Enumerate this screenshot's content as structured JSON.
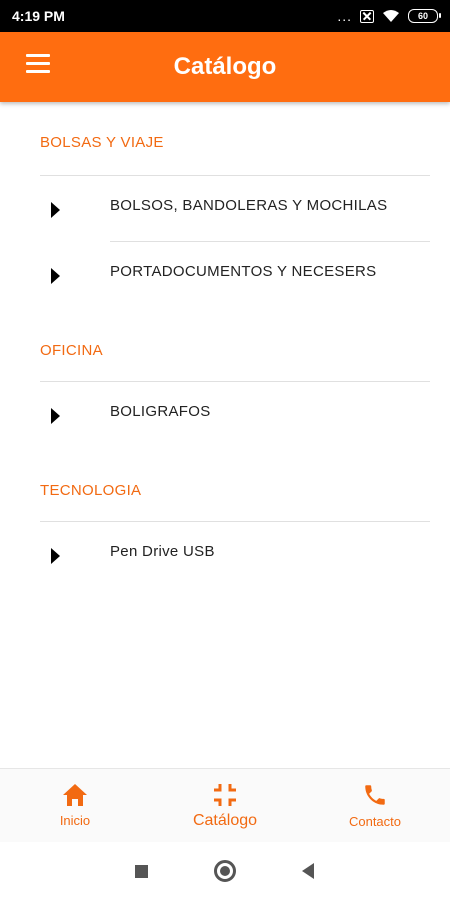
{
  "status_bar": {
    "time": "4:19 PM",
    "overflow": "...",
    "battery": "60"
  },
  "app_bar": {
    "title": "Catálogo",
    "menu_icon": "hamburger-menu-icon"
  },
  "sections": [
    {
      "title": "BOLSAS Y VIAJE",
      "items": [
        "BOLSOS, BANDOLERAS Y MOCHILAS",
        "PORTADOCUMENTOS Y NECESERS"
      ]
    },
    {
      "title": "OFICINA",
      "items": [
        "BOLIGRAFOS"
      ]
    },
    {
      "title": "TECNOLOGIA",
      "items": [
        "Pen Drive USB"
      ]
    }
  ],
  "bottom_nav": {
    "items": [
      {
        "label": "Inicio",
        "icon": "home-icon"
      },
      {
        "label": "Catálogo",
        "icon": "collapse-icon",
        "active": true
      },
      {
        "label": "Contacto",
        "icon": "phone-icon"
      }
    ]
  },
  "colors": {
    "accent": "#ff6d10",
    "section_title": "#f26a12"
  }
}
